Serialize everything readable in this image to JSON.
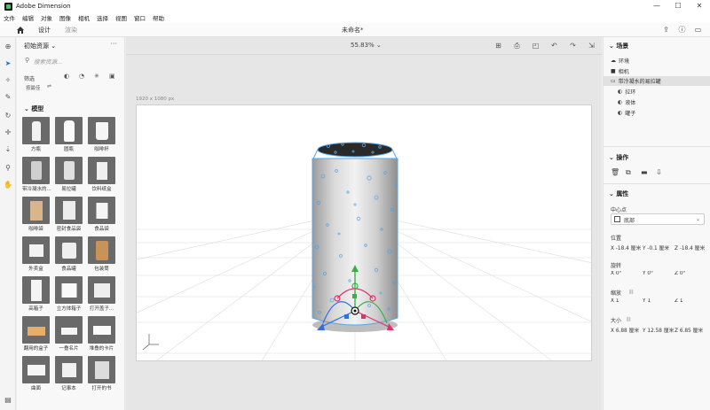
{
  "window": {
    "title": "Adobe Dimension",
    "controls": [
      "—",
      "☐",
      "✕"
    ]
  },
  "menu": [
    "文件",
    "编辑",
    "对象",
    "图像",
    "相机",
    "选择",
    "视图",
    "窗口",
    "帮助"
  ],
  "toolbar": {
    "tab_design": "设计",
    "tab_render": "渲染",
    "doc_title": "未命名*"
  },
  "left_panel": {
    "header": "初始资源",
    "search_placeholder": "搜索资源...",
    "filter_label": "筛选",
    "sort_label": "按最佳",
    "section": "模型",
    "models": [
      {
        "label": "方瓶",
        "shape": "bottle"
      },
      {
        "label": "圆瓶",
        "shape": "bottle2"
      },
      {
        "label": "咖啡杯",
        "shape": "cup"
      },
      {
        "label": "带冷凝水的...",
        "shape": "can"
      },
      {
        "label": "易拉罐",
        "shape": "can2"
      },
      {
        "label": "饮料纸盒",
        "shape": "carton"
      },
      {
        "label": "咖啡袋",
        "shape": "bag"
      },
      {
        "label": "密封食品袋",
        "shape": "pouch"
      },
      {
        "label": "食品袋",
        "shape": "bag2"
      },
      {
        "label": "外卖盒",
        "shape": "box"
      },
      {
        "label": "食品罐",
        "shape": "jar"
      },
      {
        "label": "包装筒",
        "shape": "tube"
      },
      {
        "label": "高箱子",
        "shape": "tallbox"
      },
      {
        "label": "立方体箱子",
        "shape": "cube"
      },
      {
        "label": "打开盖子...",
        "shape": "openbox"
      },
      {
        "label": "翻用的盒子",
        "shape": "flatbox"
      },
      {
        "label": "一叠名片",
        "shape": "cards"
      },
      {
        "label": "堆叠的卡片",
        "shape": "cards2"
      },
      {
        "label": "曲面",
        "shape": "paper"
      },
      {
        "label": "记事本",
        "shape": "notebook"
      },
      {
        "label": "打开的书",
        "shape": "book"
      }
    ]
  },
  "canvas": {
    "zoom": "55.83%",
    "size_label": "1920 x 1080 px"
  },
  "right_panel": {
    "scene_header": "场景",
    "scene_items": [
      "环境",
      "相机",
      "带冷凝水的易拉罐"
    ],
    "scene_sub_items": [
      "拉环",
      "液体",
      "罐子"
    ],
    "ops_header": "操作",
    "props_header": "属性",
    "center_label": "中心点",
    "center_value": "底部",
    "position_label": "位置",
    "position": {
      "x": "X  -18.4 厘米",
      "y": "Y  -0.1 厘米",
      "z": "Z  -18.4 厘米"
    },
    "rotation_label": "旋转",
    "rotation": {
      "x": "X  0°",
      "y": "Y  0°",
      "z": "Z  0°"
    },
    "scale_label": "缩放",
    "scale": {
      "x": "X  1",
      "y": "Y  1",
      "z": "Z  1"
    },
    "size_label": "大小",
    "size": {
      "x": "X  6.88 厘米",
      "y": "Y  12.58 厘米",
      "z": "Z  6.85 厘米"
    }
  }
}
